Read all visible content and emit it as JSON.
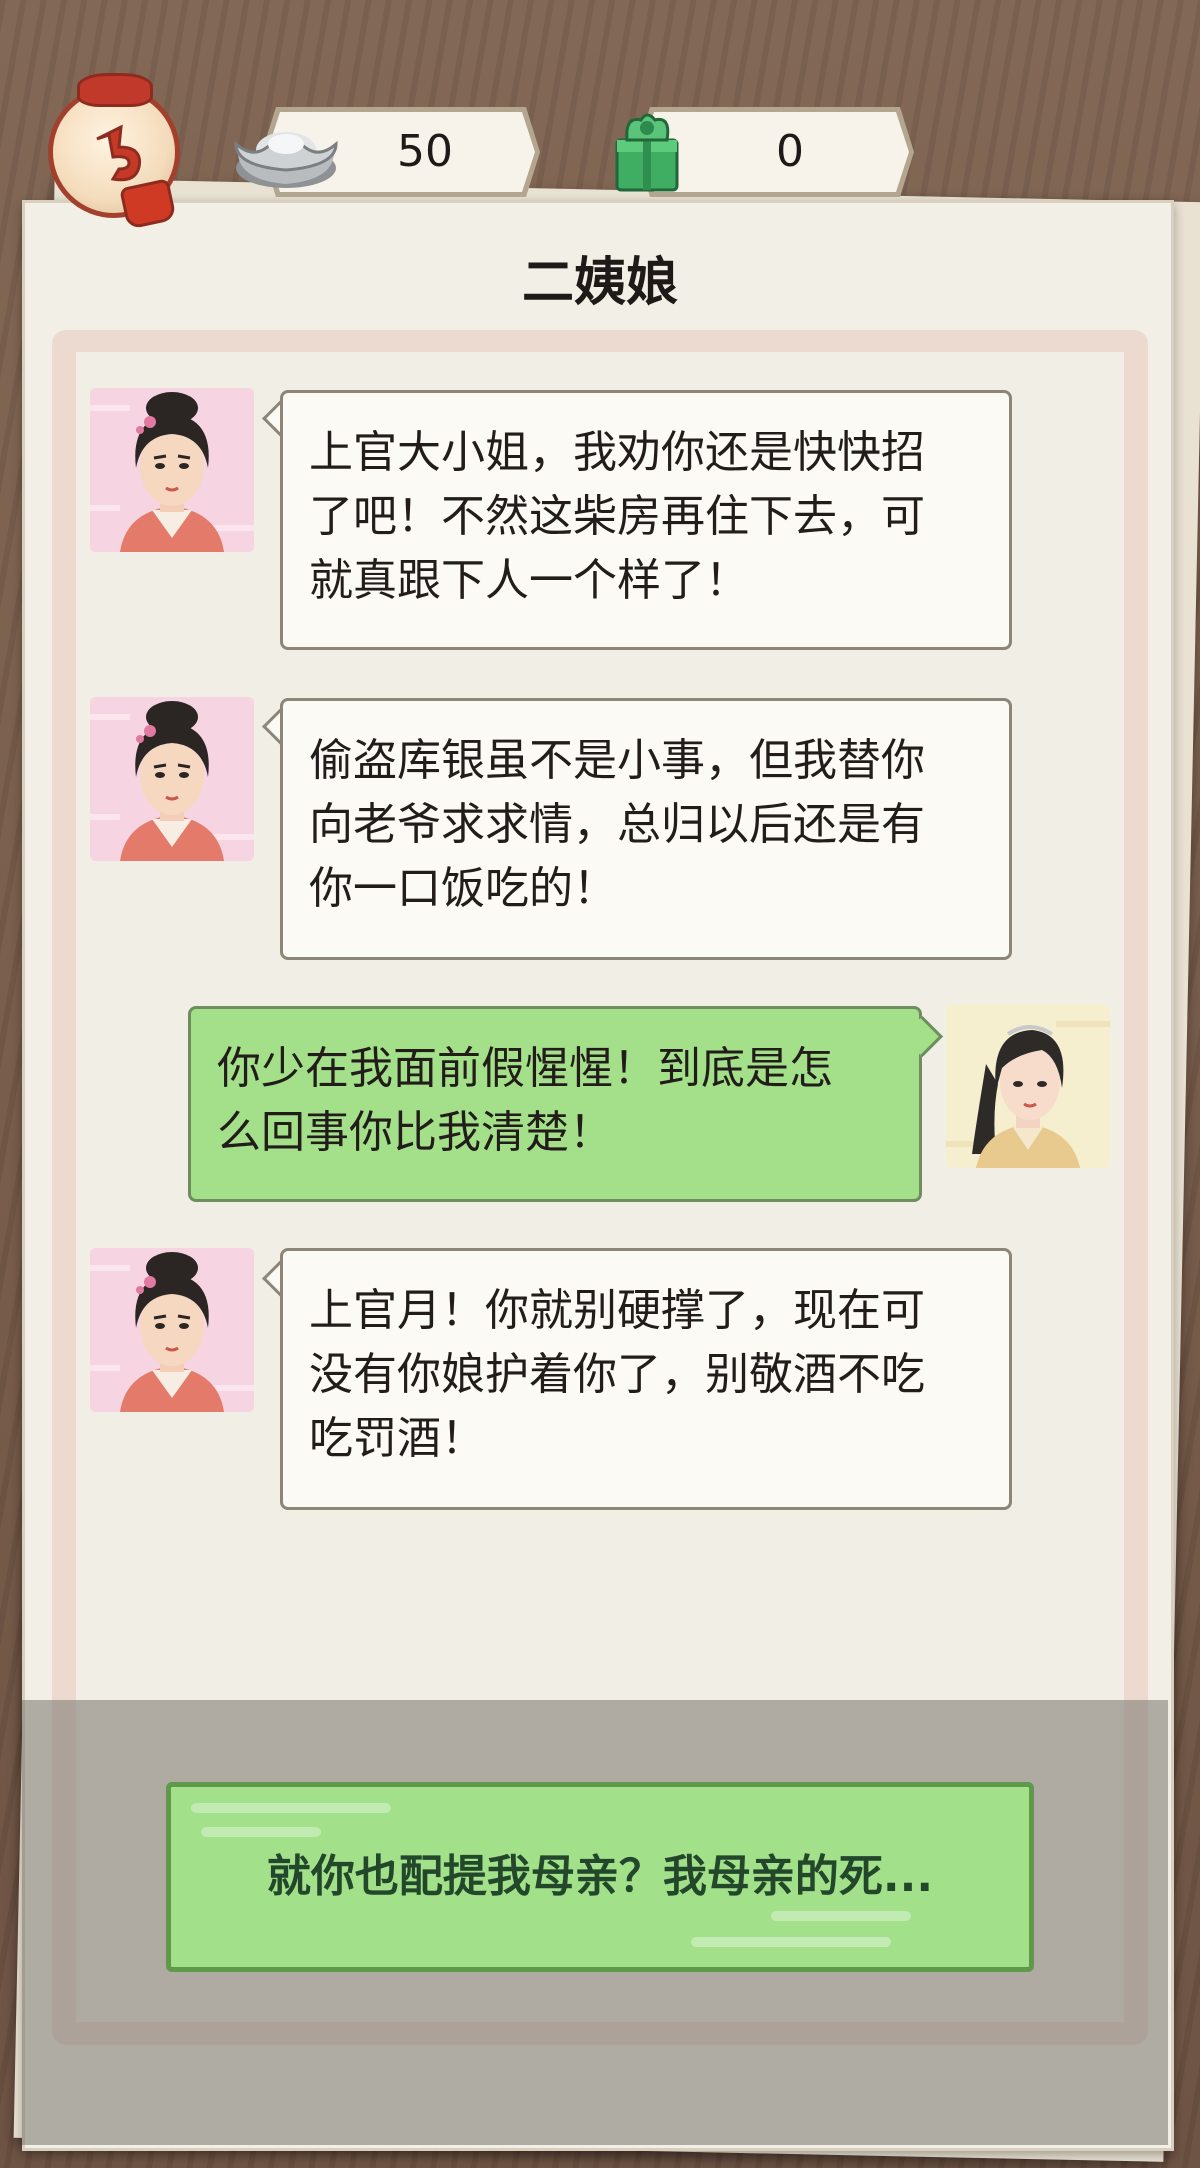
{
  "header": {
    "silver_count": "50",
    "jade_count": "0"
  },
  "title": "二姨娘",
  "messages": [
    {
      "speaker": "aunt",
      "side": "left",
      "lines": [
        "上官大小姐，我劝你还是快快招",
        "了吧！不然这柴房再住下去，可",
        "就真跟下人一个样了！"
      ]
    },
    {
      "speaker": "aunt",
      "side": "left",
      "lines": [
        "偷盗库银虽不是小事，但我替你",
        "向老爷求求情，总归以后还是有",
        "你一口饭吃的！"
      ]
    },
    {
      "speaker": "player",
      "side": "right",
      "lines": [
        "你少在我面前假惺惺！到底是怎",
        "么回事你比我清楚！"
      ]
    },
    {
      "speaker": "aunt",
      "side": "left",
      "lines": [
        "上官月！你就别硬撑了，现在可",
        "没有你娘护着你了，别敬酒不吃",
        "吃罚酒！"
      ]
    }
  ],
  "choice": {
    "label": "就你也配提我母亲？我母亲的死..."
  },
  "colors": {
    "wood": "#7a5f4f",
    "paper": "#f2efe6",
    "player_bubble": "#a4e08a",
    "npc_bubble": "#fbfaf5",
    "choice_bg": "#a2e08a"
  },
  "icons": [
    "back-swirl-icon",
    "silver-ingot-icon",
    "jade-box-icon"
  ]
}
